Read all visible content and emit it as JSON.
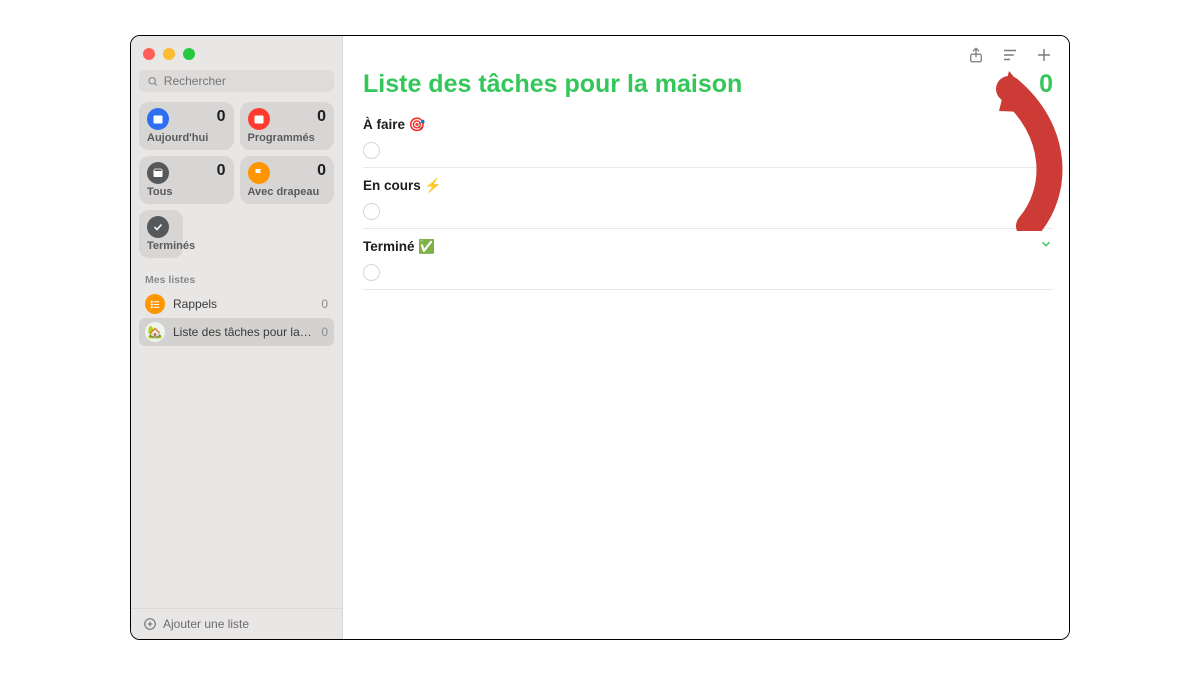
{
  "search": {
    "placeholder": "Rechercher"
  },
  "smart_lists": {
    "today": {
      "label": "Aujourd'hui",
      "count": 0,
      "color": "#2e6ff2"
    },
    "scheduled": {
      "label": "Programmés",
      "count": 0,
      "color": "#ff3b30"
    },
    "all": {
      "label": "Tous",
      "count": 0,
      "color": "#56595b"
    },
    "flagged": {
      "label": "Avec drapeau",
      "count": 0,
      "color": "#ff9500"
    },
    "completed": {
      "label": "Terminés"
    }
  },
  "sidebar": {
    "lists_heading": "Mes listes",
    "lists": [
      {
        "name": "Rappels",
        "count": 0,
        "color": "#ff9500"
      },
      {
        "name": "Liste des tâches pour la mai…",
        "count": 0,
        "color": "#33c75a"
      }
    ],
    "add_list_label": "Ajouter une liste"
  },
  "main": {
    "title": "Liste des tâches pour la maison",
    "total": 0,
    "sections": [
      {
        "title": "À faire 🎯"
      },
      {
        "title": "En cours ⚡"
      },
      {
        "title": "Terminé ✅"
      }
    ]
  },
  "colors": {
    "accent": "#33c75a"
  }
}
